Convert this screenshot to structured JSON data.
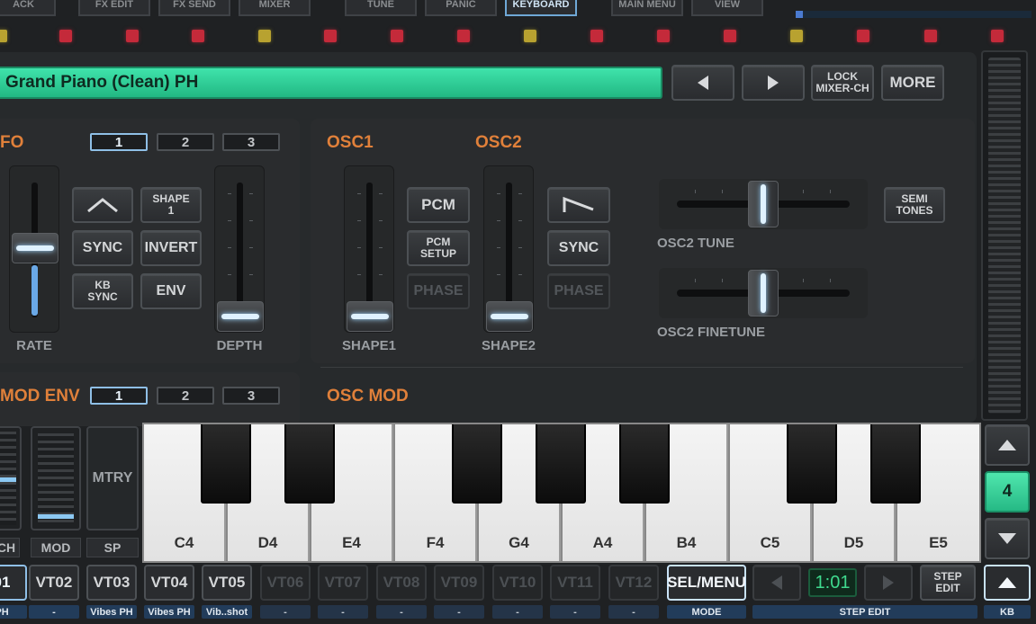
{
  "top_tabs": [
    {
      "label": "ACK",
      "active": false
    },
    {
      "label": "FX EDIT",
      "active": false
    },
    {
      "label": "FX SEND",
      "active": false
    },
    {
      "label": "MIXER",
      "active": false
    },
    {
      "label": "TUNE",
      "active": false
    },
    {
      "label": "PANIC",
      "active": false
    },
    {
      "label": "KEYBOARD",
      "active": true
    },
    {
      "label": "MAIN MENU",
      "active": false
    },
    {
      "label": "VIEW",
      "active": false
    }
  ],
  "preset": {
    "name": "Grand Piano (Clean) PH"
  },
  "header_buttons": {
    "prev_icon": "triangle-left-icon",
    "next_icon": "triangle-right-icon",
    "lock_mixer": "LOCK\nMIXER-CH",
    "more": "MORE"
  },
  "lfo": {
    "title": "FO",
    "tabs": [
      "1",
      "2",
      "3"
    ],
    "buttons": {
      "shape_wave_icon": "triangle-wave-icon",
      "shape": "SHAPE\n1",
      "sync": "SYNC",
      "invert": "INVERT",
      "kb_sync": "KB\nSYNC",
      "env": "ENV"
    },
    "labels": {
      "rate": "RATE",
      "depth": "DEPTH"
    },
    "rate_level": 0.5,
    "depth_level": 0.0
  },
  "osc": {
    "osc1_title": "OSC1",
    "osc2_title": "OSC2",
    "buttons": {
      "pcm": "PCM",
      "pcm_setup": "PCM\nSETUP",
      "phase1": "PHASE",
      "saw_icon": "saw-wave-icon",
      "sync": "SYNC",
      "phase2": "PHASE",
      "semitones": "SEMI\nTONES"
    },
    "labels": {
      "shape1": "SHAPE1",
      "shape2": "SHAPE2",
      "osc2_tune": "OSC2 TUNE",
      "osc2_finetune": "OSC2 FINETUNE"
    },
    "shape1_level": 0.0,
    "shape2_level": 0.0,
    "osc2_tune_level": 0.5,
    "osc2_finetune_level": 0.5
  },
  "mod_env": {
    "title": "MOD ENV",
    "tabs": [
      "1",
      "2",
      "3"
    ]
  },
  "osc_mod": {
    "title": "OSC MOD"
  },
  "left_controls": {
    "pitch_label": "CH",
    "mod_label": "MOD",
    "mtry": "MTRY",
    "sp_label": "SP"
  },
  "keys": [
    "C4",
    "D4",
    "E4",
    "F4",
    "G4",
    "A4",
    "B4",
    "C5",
    "D5",
    "E5"
  ],
  "octave": {
    "up_icon": "triangle-up-icon",
    "value": "4",
    "down_icon": "triangle-down-icon"
  },
  "tracks": [
    {
      "label": "01",
      "sub": "PH",
      "dim": false
    },
    {
      "label": "VT02",
      "sub": "-",
      "dim": false
    },
    {
      "label": "VT03",
      "sub": "Vibes PH",
      "dim": false
    },
    {
      "label": "VT04",
      "sub": "Vibes PH",
      "dim": false
    },
    {
      "label": "VT05",
      "sub": "Vib..shot",
      "dim": false
    },
    {
      "label": "VT06",
      "sub": "-",
      "dim": true
    },
    {
      "label": "VT07",
      "sub": "-",
      "dim": true
    },
    {
      "label": "VT08",
      "sub": "-",
      "dim": true
    },
    {
      "label": "VT09",
      "sub": "-",
      "dim": true
    },
    {
      "label": "VT10",
      "sub": "-",
      "dim": true
    },
    {
      "label": "VT11",
      "sub": "-",
      "dim": true
    },
    {
      "label": "VT12",
      "sub": "-",
      "dim": true
    }
  ],
  "bottom_right": {
    "sel_menu": "SEL/MENU",
    "mode_label": "MODE",
    "position": "1:01",
    "step_edit_btn": "STEP\nEDIT",
    "step_edit_label": "STEP EDIT",
    "kb_label": "KB",
    "kb_icon": "triangle-up-icon"
  },
  "colors": {
    "accent_orange": "#e0803a",
    "preset_green": "#2fd69a",
    "octave_green": "#39d49a",
    "active_blue": "#8fbfe6",
    "led_red": "#c42a3a"
  }
}
